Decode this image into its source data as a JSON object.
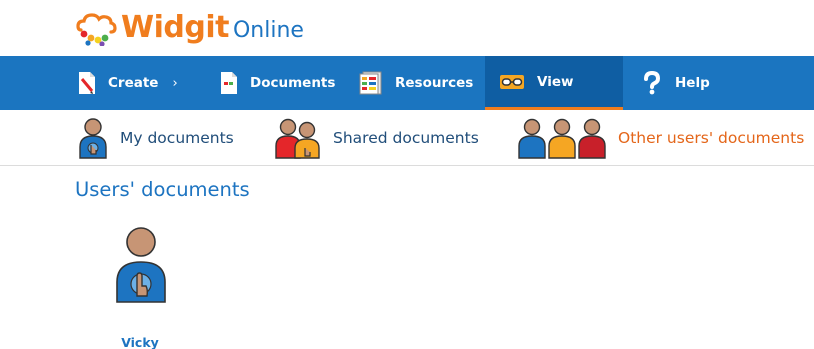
{
  "app": {
    "logo_name": "Widgit",
    "logo_suffix": "Online"
  },
  "nav": {
    "items": [
      {
        "label": "Create",
        "chevron": "›",
        "icon": "pencil-document-icon"
      },
      {
        "label": "Documents",
        "icon": "document-icon"
      },
      {
        "label": "Resources",
        "icon": "resources-icon"
      },
      {
        "label": "View",
        "icon": "glasses-icon",
        "active": true
      },
      {
        "label": "Help",
        "icon": "question-icon"
      }
    ]
  },
  "subtabs": {
    "items": [
      {
        "label": "My documents",
        "icon": "single-person-icon"
      },
      {
        "label": "Shared documents",
        "icon": "two-people-icon"
      },
      {
        "label": "Other users' documents",
        "icon": "three-people-icon",
        "active": true
      }
    ]
  },
  "content": {
    "title": "Users' documents",
    "users": [
      {
        "name": "Vicky",
        "icon": "person-pointing-icon"
      }
    ]
  },
  "colors": {
    "nav_bg": "#1b75c0",
    "nav_active_bg": "#0f5ea3",
    "accent_orange": "#f07d1e",
    "link_blue": "#1d74c1"
  }
}
